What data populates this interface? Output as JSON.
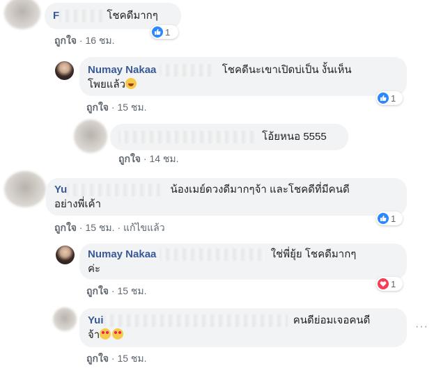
{
  "comments": [
    {
      "name": "F",
      "text": "โชคดีมากๆ",
      "like_label": "ถูกใจ",
      "time": "16 ชม.",
      "reaction_count": "1"
    },
    {
      "name": "Numay Nakaa",
      "text_line1": "โชคดีนะเขาเปิดบ่เป็น งั้นเห็น",
      "text_line2": "โพยแล้ว",
      "like_label": "ถูกใจ",
      "time": "15 ชม.",
      "reaction_count": "1"
    },
    {
      "text": "โอ้ยหนอ 5555",
      "like_label": "ถูกใจ",
      "time": "14 ชม."
    },
    {
      "name": "Yu",
      "text_line1": "น้องเมย์ดวงดีมากๆจ้า และโชคดีที่มีคนดี",
      "text_line2": "อย่างพี่เค้า",
      "like_label": "ถูกใจ",
      "time": "15 ชม.",
      "edited": "แก้ไขแล้ว",
      "reaction_count": "1"
    },
    {
      "name": "Numay Nakaa",
      "text_line1": "ใช่พี่ยุ้ย โชคดีมากๆ",
      "text_line2": "ค่ะ",
      "like_label": "ถูกใจ",
      "time": "15 ชม.",
      "reaction_count": "1"
    },
    {
      "name": "Yui",
      "text_line1": "คนดีย่อมเจอคนดี",
      "text_line2": "จ้า",
      "like_label": "ถูกใจ",
      "time": "15 ชม."
    }
  ],
  "separator": "·",
  "icons": {
    "like": "thumbs-up-icon",
    "love": "heart-icon",
    "more": "more-options-icon"
  },
  "colors": {
    "name": "#385898",
    "bubble": "#f2f3f5",
    "meta": "#606770",
    "like": "#2d88ff",
    "love": "#f33e58"
  }
}
